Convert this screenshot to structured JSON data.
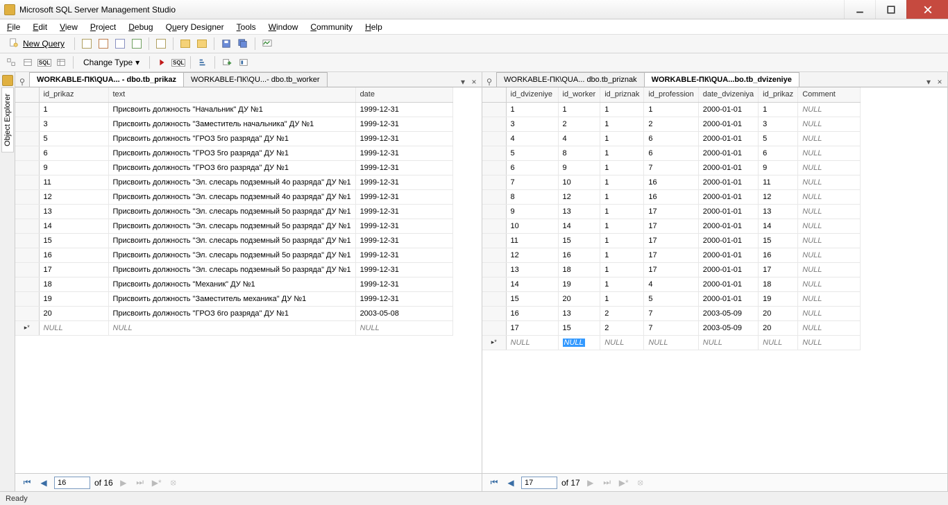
{
  "app": {
    "title": "Microsoft SQL Server Management Studio"
  },
  "menubar": [
    "File",
    "Edit",
    "View",
    "Project",
    "Debug",
    "Query Designer",
    "Tools",
    "Window",
    "Community",
    "Help"
  ],
  "toolbar": {
    "new_query": "New Query",
    "change_type": "Change Type"
  },
  "sidebar": {
    "object_explorer": "Object Explorer"
  },
  "left_tabs": [
    {
      "label": "WORKABLE-ПК\\QUA... - dbo.tb_prikaz",
      "active": true
    },
    {
      "label": "WORKABLE-ПК\\QU...- dbo.tb_worker",
      "active": false
    }
  ],
  "right_tabs": [
    {
      "label": "WORKABLE-ПК\\QUA... dbo.tb_priznak",
      "active": false
    },
    {
      "label": "WORKABLE-ПК\\QUA...bo.tb_dvizeniye",
      "active": true
    }
  ],
  "left_table": {
    "columns": [
      "id_prikaz",
      "text",
      "date"
    ],
    "rows": [
      [
        "1",
        "Присвоить должность \"Начальник\" ДУ №1",
        "1999-12-31"
      ],
      [
        "3",
        "Присвоить должность \"Заместитель начальника\" ДУ №1",
        "1999-12-31"
      ],
      [
        "5",
        "Присвоить должность \"ГРОЗ 5го разряда\" ДУ №1",
        "1999-12-31"
      ],
      [
        "6",
        "Присвоить должность \"ГРОЗ 5го разряда\" ДУ №1",
        "1999-12-31"
      ],
      [
        "9",
        "Присвоить должность \"ГРОЗ 6го разряда\" ДУ №1",
        "1999-12-31"
      ],
      [
        "11",
        "Присвоить должность \"Эл. слесарь подземный 4о разряда\" ДУ №1",
        "1999-12-31"
      ],
      [
        "12",
        "Присвоить должность \"Эл. слесарь подземный 4о разряда\" ДУ №1",
        "1999-12-31"
      ],
      [
        "13",
        "Присвоить должность \"Эл. слесарь подземный 5о разряда\" ДУ №1",
        "1999-12-31"
      ],
      [
        "14",
        "Присвоить должность \"Эл. слесарь подземный 5о разряда\" ДУ №1",
        "1999-12-31"
      ],
      [
        "15",
        "Присвоить должность \"Эл. слесарь подземный 5о разряда\" ДУ №1",
        "1999-12-31"
      ],
      [
        "16",
        "Присвоить должность \"Эл. слесарь подземный 5о разряда\" ДУ №1",
        "1999-12-31"
      ],
      [
        "17",
        "Присвоить должность \"Эл. слесарь подземный 5о разряда\" ДУ №1",
        "1999-12-31"
      ],
      [
        "18",
        "Присвоить должность \"Механик\" ДУ №1",
        "1999-12-31"
      ],
      [
        "19",
        "Присвоить должность \"Заместитель механика\" ДУ №1",
        "1999-12-31"
      ],
      [
        "20",
        "Присвоить должность \"ГРОЗ 6го разряда\" ДУ №1",
        "2003-05-08"
      ]
    ],
    "null_label": "NULL"
  },
  "right_table": {
    "columns": [
      "id_dvizeniye",
      "id_worker",
      "id_priznak",
      "id_profession",
      "date_dvizeniya",
      "id_prikaz",
      "Comment"
    ],
    "rows": [
      [
        "1",
        "1",
        "1",
        "1",
        "2000-01-01",
        "1",
        "NULL"
      ],
      [
        "3",
        "2",
        "1",
        "2",
        "2000-01-01",
        "3",
        "NULL"
      ],
      [
        "4",
        "4",
        "1",
        "6",
        "2000-01-01",
        "5",
        "NULL"
      ],
      [
        "5",
        "8",
        "1",
        "6",
        "2000-01-01",
        "6",
        "NULL"
      ],
      [
        "6",
        "9",
        "1",
        "7",
        "2000-01-01",
        "9",
        "NULL"
      ],
      [
        "7",
        "10",
        "1",
        "16",
        "2000-01-01",
        "11",
        "NULL"
      ],
      [
        "8",
        "12",
        "1",
        "16",
        "2000-01-01",
        "12",
        "NULL"
      ],
      [
        "9",
        "13",
        "1",
        "17",
        "2000-01-01",
        "13",
        "NULL"
      ],
      [
        "10",
        "14",
        "1",
        "17",
        "2000-01-01",
        "14",
        "NULL"
      ],
      [
        "11",
        "15",
        "1",
        "17",
        "2000-01-01",
        "15",
        "NULL"
      ],
      [
        "12",
        "16",
        "1",
        "17",
        "2000-01-01",
        "16",
        "NULL"
      ],
      [
        "13",
        "18",
        "1",
        "17",
        "2000-01-01",
        "17",
        "NULL"
      ],
      [
        "14",
        "19",
        "1",
        "4",
        "2000-01-01",
        "18",
        "NULL"
      ],
      [
        "15",
        "20",
        "1",
        "5",
        "2000-01-01",
        "19",
        "NULL"
      ],
      [
        "16",
        "13",
        "2",
        "7",
        "2003-05-09",
        "20",
        "NULL"
      ],
      [
        "17",
        "15",
        "2",
        "7",
        "2003-05-09",
        "20",
        "NULL"
      ]
    ],
    "null_label": "NULL"
  },
  "nav": {
    "left": {
      "current": "16",
      "of_label": "of 16"
    },
    "right": {
      "current": "17",
      "of_label": "of 17"
    }
  },
  "status": {
    "ready": "Ready"
  }
}
